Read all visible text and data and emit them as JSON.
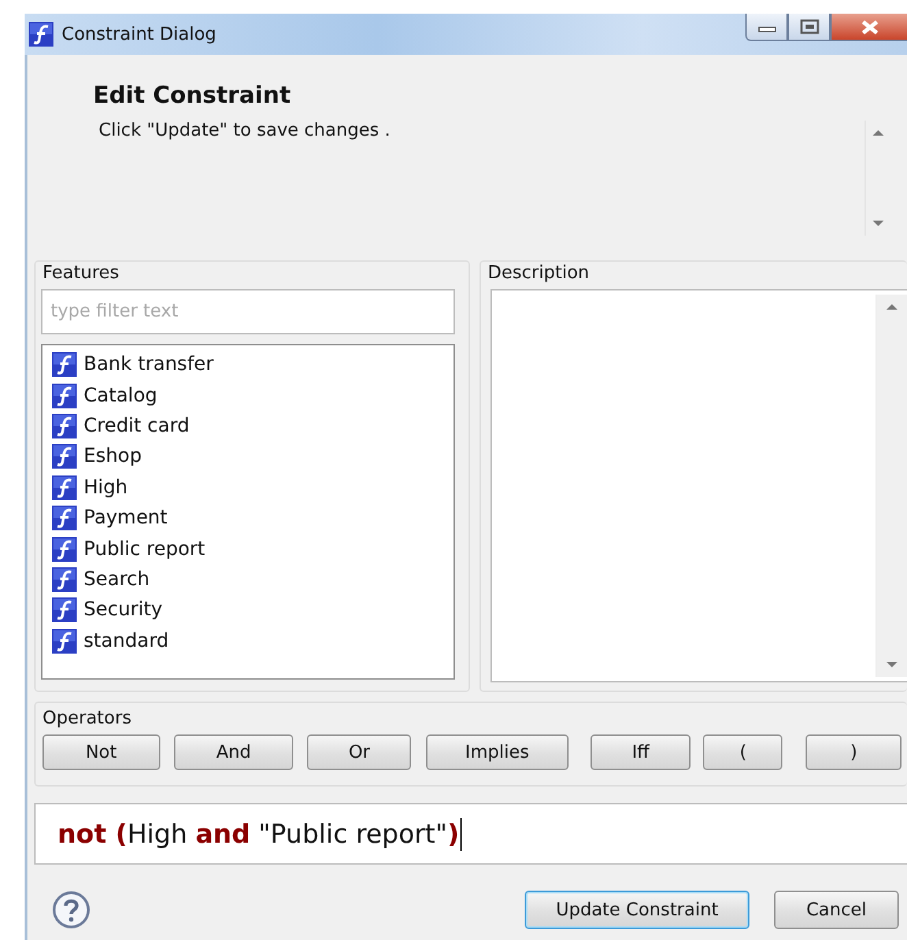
{
  "window": {
    "title": "Constraint Dialog"
  },
  "header": {
    "title": "Edit Constraint",
    "message": "Click \"Update\" to save changes ."
  },
  "features": {
    "label": "Features",
    "filter": {
      "placeholder": "type filter text"
    },
    "items": [
      "Bank transfer",
      "Catalog",
      "Credit card",
      "Eshop",
      "High",
      "Payment",
      "Public report",
      "Search",
      "Security",
      "standard"
    ]
  },
  "description": {
    "label": "Description"
  },
  "operators": {
    "label": "Operators",
    "buttons": [
      "Not",
      "And",
      "Or",
      "Implies",
      "Iff",
      "(",
      ")"
    ]
  },
  "expression": {
    "value": "**not (**High **and** \"Public report\"**)**"
  },
  "buttons": [
    {
      "label": "Update Constraint",
      "default": true
    },
    {
      "label": "Cancel",
      "default": false
    }
  ]
}
